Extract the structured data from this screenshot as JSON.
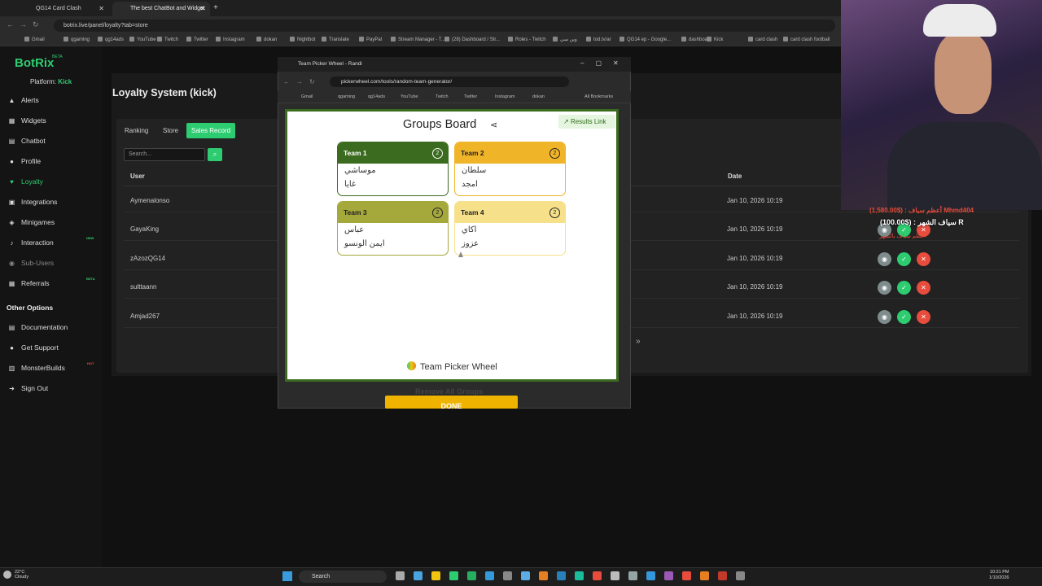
{
  "browser": {
    "tabs": [
      {
        "title": "QG14 Card Clash",
        "active": false
      },
      {
        "title": "The best ChatBot and Widget",
        "active": true
      }
    ],
    "url": "botrix.live/panel/loyalty?tab=store",
    "bookmarks": [
      "Gmail",
      "qgaming",
      "qg14ads",
      "YouTube",
      "Twitch",
      "Twitter",
      "Instagram",
      "dokan",
      "Nightbot",
      "Translate",
      "PayPal",
      "Stream Manager - T...",
      "(28) Dashboard / Str...",
      "Roles - Twitch",
      "وين سي",
      "tod.tv/ar",
      "QG14 ep - Google...",
      "dashboard",
      "Kick",
      "card clash",
      "card clash football"
    ]
  },
  "sidebar": {
    "logo": "BotRix",
    "logo_badge": "BETA",
    "platform_label": "Platform:",
    "platform_value": "Kick",
    "items": [
      {
        "label": "Alerts",
        "icon": "warning-icon"
      },
      {
        "label": "Widgets",
        "icon": "grid-icon"
      },
      {
        "label": "Chatbot",
        "icon": "chat-icon"
      },
      {
        "label": "Profile",
        "icon": "user-icon"
      },
      {
        "label": "Loyalty",
        "icon": "heart-icon",
        "selected": true
      },
      {
        "label": "Integrations",
        "icon": "puzzle-icon"
      },
      {
        "label": "Minigames",
        "icon": "gamepad-icon"
      },
      {
        "label": "Interaction",
        "icon": "music-icon",
        "badge": "NEW"
      },
      {
        "label": "Sub-Users",
        "icon": "users-icon",
        "dim": true
      },
      {
        "label": "Referrals",
        "icon": "gift-icon",
        "badge": "BETA"
      }
    ],
    "other_heading": "Other Options",
    "other_items": [
      {
        "label": "Documentation",
        "icon": "book-icon"
      },
      {
        "label": "Get Support",
        "icon": "help-icon"
      },
      {
        "label": "MonsterBuilds",
        "icon": "server-icon",
        "badge": "HOT"
      },
      {
        "label": "Sign Out",
        "icon": "logout-icon"
      }
    ]
  },
  "page": {
    "title": "Loyalty System (kick)",
    "tabs": [
      "Ranking",
      "Store",
      "Sales Record"
    ],
    "active_tab": "Sales Record",
    "search_placeholder": "Search...",
    "columns": {
      "user": "User",
      "date": "Date"
    },
    "rows": [
      {
        "user": "Aymenalonso",
        "date": "Jan 10, 2026 10:19"
      },
      {
        "user": "GayaKing",
        "date": "Jan 10, 2026 10:19"
      },
      {
        "user": "zAzozQG14",
        "date": "Jan 10, 2026 10:19"
      },
      {
        "user": "sulttaann",
        "date": "Jan 10, 2026 10:19"
      },
      {
        "user": "Amjad267",
        "date": "Jan 10, 2026 10:19"
      }
    ],
    "pager_next": "»"
  },
  "popup": {
    "tab_title": "Team Picker Wheel - Randi",
    "url": "pickerwheel.com/tools/random-team-generator/",
    "bookmarks": [
      "Gmail",
      "qgaming",
      "qg14ads",
      "YouTube",
      "Twitch",
      "Twitter",
      "Instagram",
      "dokan"
    ],
    "all_bookmarks": "All Bookmarks",
    "board_title": "Groups Board",
    "results_link": "Results Link",
    "teams": [
      {
        "name": "Team 1",
        "count": "2",
        "color": "#3a6b1e",
        "text_color": "#ffffff",
        "members": [
          "موساشي",
          "غايا"
        ]
      },
      {
        "name": "Team 2",
        "count": "2",
        "color": "#f0b429",
        "text_color": "#222222",
        "members": [
          "سلطان",
          "امجد"
        ]
      },
      {
        "name": "Team 3",
        "count": "2",
        "color": "#a5a83a",
        "text_color": "#222222",
        "members": [
          "عباس",
          "ايمن الونسو"
        ]
      },
      {
        "name": "Team 4",
        "count": "2",
        "color": "#f7e08a",
        "text_color": "#222222",
        "members": [
          "اكاي",
          "عزوز"
        ]
      }
    ],
    "footer": "Team Picker Wheel",
    "remove_label": "Remove All Groups",
    "done_label": "DONE"
  },
  "overlay": {
    "ticker_top": "أعظم سياف : ($1,580.00) Mhmd404",
    "ticker_main": "سياف الشهر : ($100.00) R",
    "ticker_bottom": "أعظم سياف بالشهر"
  },
  "taskbar": {
    "temp": "22°C",
    "weather": "Cloudy",
    "search": "Search",
    "time": "10:21 PM",
    "date": "1/10/2026"
  },
  "colors": {
    "accent": "#2ecc71",
    "danger": "#e74c3c",
    "view": "#7f8c8d"
  }
}
